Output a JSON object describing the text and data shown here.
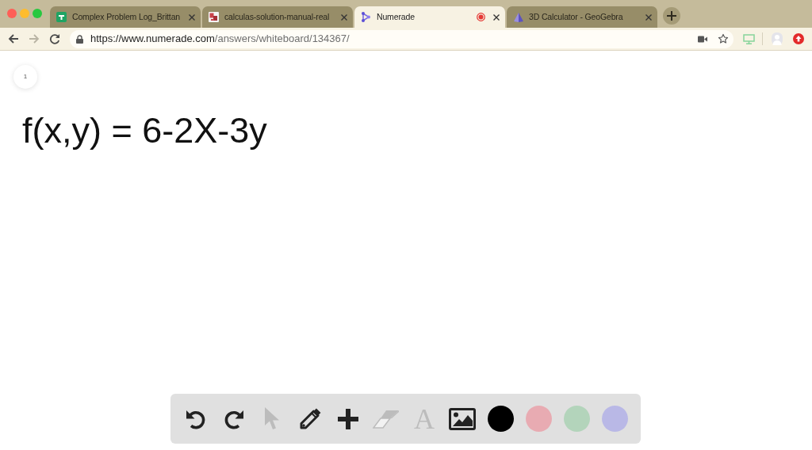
{
  "tabs": [
    {
      "title": "Complex Problem Log_Brittan",
      "kind": "spreadsheet",
      "selected": false,
      "recording": false
    },
    {
      "title": "calculas-solution-manual-real",
      "kind": "pdf",
      "selected": false,
      "recording": false
    },
    {
      "title": "Numerade",
      "kind": "nodes",
      "selected": true,
      "recording": true
    },
    {
      "title": "3D Calculator - GeoGebra",
      "kind": "pyramid",
      "selected": false,
      "recording": false
    }
  ],
  "toolbar": {
    "nav": [
      {
        "kind": "back",
        "disabled": false
      },
      {
        "kind": "forward",
        "disabled": true
      },
      {
        "kind": "reload",
        "disabled": false
      }
    ],
    "url_host": "https://www.numerade.com",
    "url_path": "/answers/whiteboard/134367/"
  },
  "whiteboard": {
    "page_number": "1",
    "content": "f(x,y) = 6-2X-3y"
  },
  "tools": [
    {
      "kind": "undo",
      "disabled": false
    },
    {
      "kind": "redo",
      "disabled": false
    },
    {
      "kind": "select",
      "disabled": true
    },
    {
      "kind": "pen",
      "disabled": false
    },
    {
      "kind": "add",
      "disabled": false
    },
    {
      "kind": "eraser",
      "disabled": true
    },
    {
      "kind": "text",
      "label": "A",
      "disabled": true
    },
    {
      "kind": "image",
      "disabled": false
    }
  ],
  "colors": [
    {
      "color": "#000000"
    },
    {
      "color": "#e8abb2"
    },
    {
      "color": "#b3d4bb"
    },
    {
      "color": "#b9b8e6"
    }
  ]
}
